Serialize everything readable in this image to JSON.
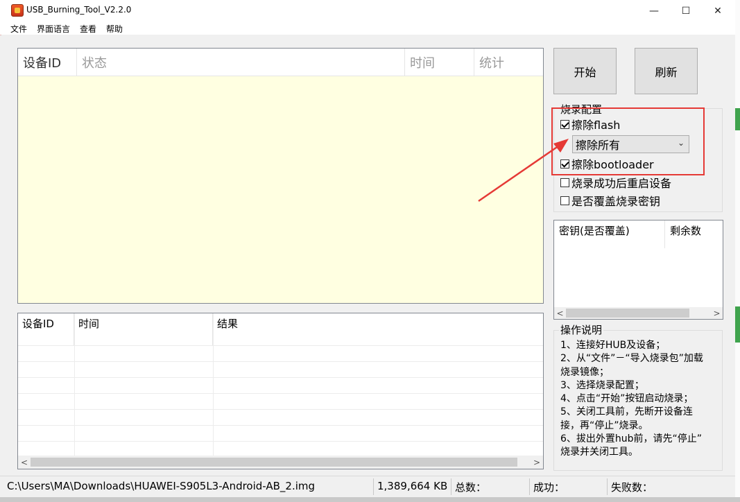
{
  "window": {
    "title": "USB_Burning_Tool_V2.2.0",
    "controls": {
      "minimize": "—",
      "maximize": "☐",
      "close": "✕"
    }
  },
  "menu": [
    "文件",
    "界面语言",
    "查看",
    "帮助"
  ],
  "device_table": {
    "columns": [
      "设备ID",
      "状态",
      "时间",
      "统计"
    ],
    "rows": []
  },
  "log_table": {
    "columns": [
      "设备ID",
      "时间",
      "结果"
    ],
    "rows": []
  },
  "buttons": {
    "start": "开始",
    "refresh": "刷新"
  },
  "config": {
    "title": "烧录配置",
    "erase_flash": {
      "label": "擦除flash",
      "checked": true
    },
    "erase_mode": {
      "selected": "擦除所有"
    },
    "erase_bootloader": {
      "label": "擦除bootloader",
      "checked": true
    },
    "reboot_after_success": {
      "label": "烧录成功后重启设备",
      "checked": false
    },
    "overwrite_key": {
      "label": "是否覆盖烧录密钥",
      "checked": false
    }
  },
  "key_table": {
    "columns": [
      "密钥(是否覆盖)",
      "剩余数"
    ]
  },
  "instructions": {
    "title": "操作说明",
    "lines": [
      "1、连接好HUB及设备；",
      "2、从“文件”－“导入烧录包”加载",
      "烧录镜像；",
      "3、选择烧录配置；",
      "4、点击“开始”按钮启动烧录；",
      "5、关闭工具前，先断开设备连",
      "接，再“停止”烧录。",
      "6、拔出外置hub前，请先“停止”",
      "烧录并关闭工具。"
    ]
  },
  "status": {
    "path": "C:\\Users\\MA\\Downloads\\HUAWEI-S905L3-Android-AB_2.img",
    "size": "1,389,664 KB",
    "total_label": "总数：",
    "success_label": "成功：",
    "fail_label": "失败数："
  },
  "colors": {
    "highlight": "#e53935",
    "device_table_bg": "#ffffe1"
  }
}
